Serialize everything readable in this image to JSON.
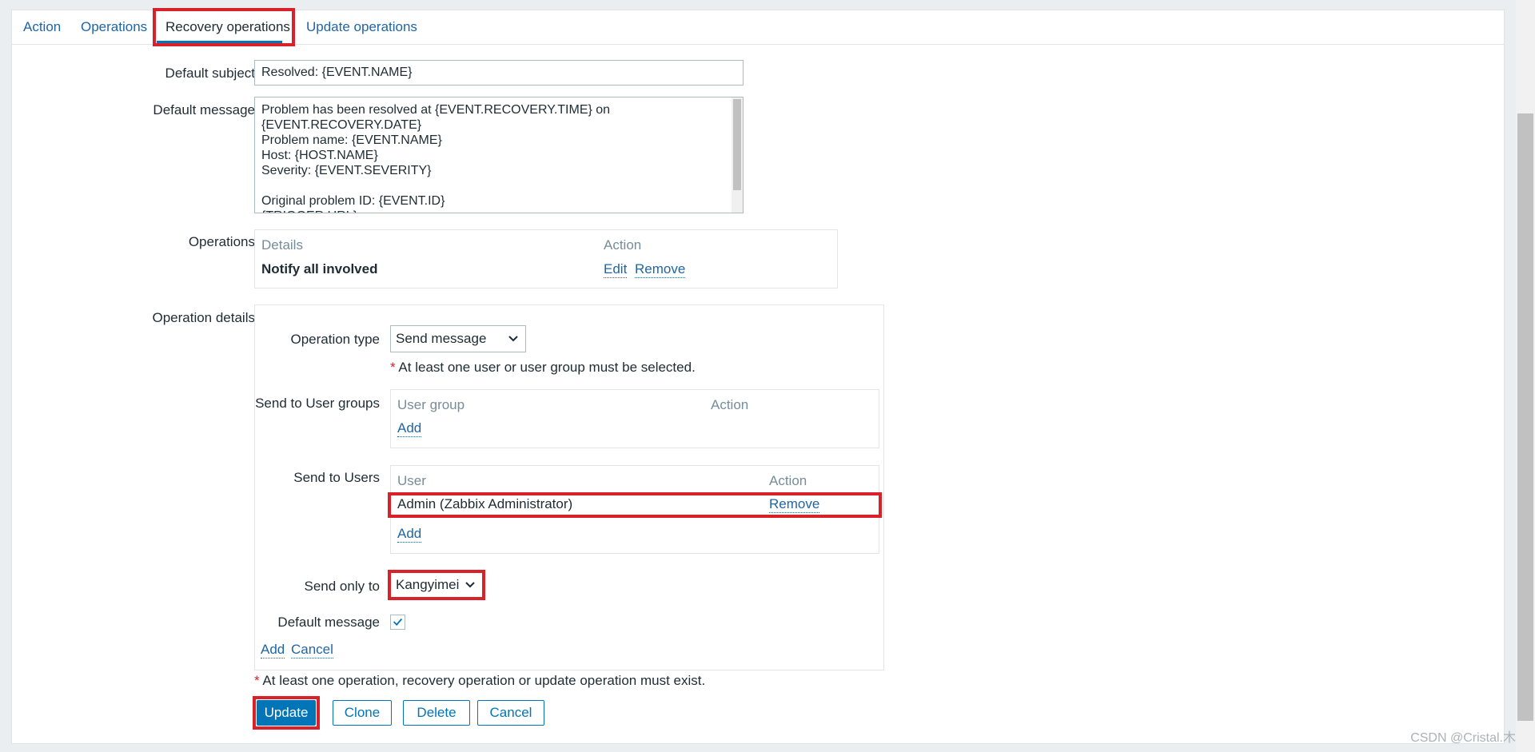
{
  "tabs": [
    {
      "label": "Action"
    },
    {
      "label": "Operations"
    },
    {
      "label": "Recovery operations"
    },
    {
      "label": "Update operations"
    }
  ],
  "form": {
    "default_subject_label": "Default subject",
    "default_subject_value": "Resolved: {EVENT.NAME}",
    "default_message_label": "Default message",
    "default_message_value": "Problem has been resolved at {EVENT.RECOVERY.TIME} on\n{EVENT.RECOVERY.DATE}\nProblem name: {EVENT.NAME}\nHost: {HOST.NAME}\nSeverity: {EVENT.SEVERITY}\n\nOriginal problem ID: {EVENT.ID}\n{TRIGGER.URL}",
    "operations_label": "Operations",
    "operations_table": {
      "col_details": "Details",
      "col_action": "Action",
      "rows": [
        {
          "details": "Notify all involved",
          "edit": "Edit",
          "remove": "Remove"
        }
      ]
    },
    "operation_details_label": "Operation details",
    "details": {
      "operation_type_label": "Operation type",
      "operation_type_value": "Send message",
      "required_note": "At least one user or user group must be selected.",
      "user_groups_label": "Send to User groups",
      "user_groups_table": {
        "col_group": "User group",
        "col_action": "Action",
        "add": "Add"
      },
      "users_label": "Send to Users",
      "users_table": {
        "col_user": "User",
        "col_action": "Action",
        "rows": [
          {
            "user": "Admin (Zabbix Administrator)",
            "remove": "Remove"
          }
        ],
        "add": "Add"
      },
      "send_only_to_label": "Send only to",
      "send_only_to_value": "Kangyimei",
      "default_message_label": "Default message",
      "default_message_checked": true,
      "add_link": "Add",
      "cancel_link": "Cancel"
    },
    "bottom_note": "At least one operation, recovery operation or update operation must exist.",
    "buttons": {
      "update": "Update",
      "clone": "Clone",
      "delete": "Delete",
      "cancel": "Cancel"
    }
  },
  "watermark": "CSDN @Cristal.木",
  "colors": {
    "accent": "#0275b8",
    "link": "#1f65a6",
    "highlight": "#d9212a"
  }
}
